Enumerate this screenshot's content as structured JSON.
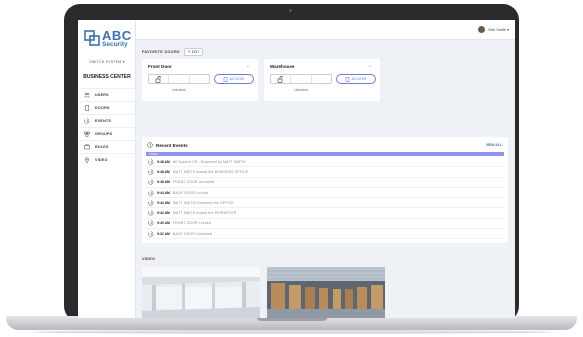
{
  "header": {
    "user_name": "Rob Smith ▾"
  },
  "sidebar": {
    "logo_text": "ABC",
    "logo_subtext": "Security",
    "switch_label": "SWITCH SYSTEM ▾",
    "business_name": "BUSINESS CENTER",
    "items": [
      {
        "label": "USERS",
        "icon": "users-icon"
      },
      {
        "label": "DOORS",
        "icon": "door-icon"
      },
      {
        "label": "EVENTS",
        "icon": "events-icon"
      },
      {
        "label": "GROUPS",
        "icon": "groups-icon"
      },
      {
        "label": "RULES",
        "icon": "rules-icon"
      },
      {
        "label": "VIDEO",
        "icon": "video-icon"
      }
    ]
  },
  "favorites": {
    "title": "FAVORITE DOORS",
    "edit_label": "EDIT",
    "doors": [
      {
        "name": "Front Door",
        "access_label": "ACCESS",
        "status": "Unlocked"
      },
      {
        "name": "Warehouse",
        "access_label": "ACCESS",
        "status": "Unlocked"
      }
    ]
  },
  "events": {
    "title": "Recent Events",
    "view_all": "VIEW ALL",
    "group_label": "TODAY",
    "rows": [
      {
        "time": "9:48 AM",
        "text": "All System Off - Disarmed by MATT SMITH"
      },
      {
        "time": "9:48 AM",
        "text": "MATT SMITH Armed the BUSINESS OFFICE"
      },
      {
        "time": "9:48 AM",
        "text": "FRONT DOOR Unlocked"
      },
      {
        "time": "9:44 AM",
        "text": "BACK DOOR Locked"
      },
      {
        "time": "9:44 AM",
        "text": "MATT SMITH Disarmed the OFFICE"
      },
      {
        "time": "9:42 AM",
        "text": "MATT SMITH Armed the PERIMETER"
      },
      {
        "time": "9:40 AM",
        "text": "FRONT DOOR Locked"
      },
      {
        "time": "9:32 AM",
        "text": "BACK DOOR Unlocked"
      }
    ]
  },
  "video": {
    "title": "VIDEO",
    "feeds": [
      {
        "icon": "office-camera-feed"
      },
      {
        "icon": "warehouse-camera-feed"
      }
    ]
  },
  "colors": {
    "brand": "#3b6fb8",
    "accent": "#8f94ee",
    "link": "#4f5fc2"
  }
}
